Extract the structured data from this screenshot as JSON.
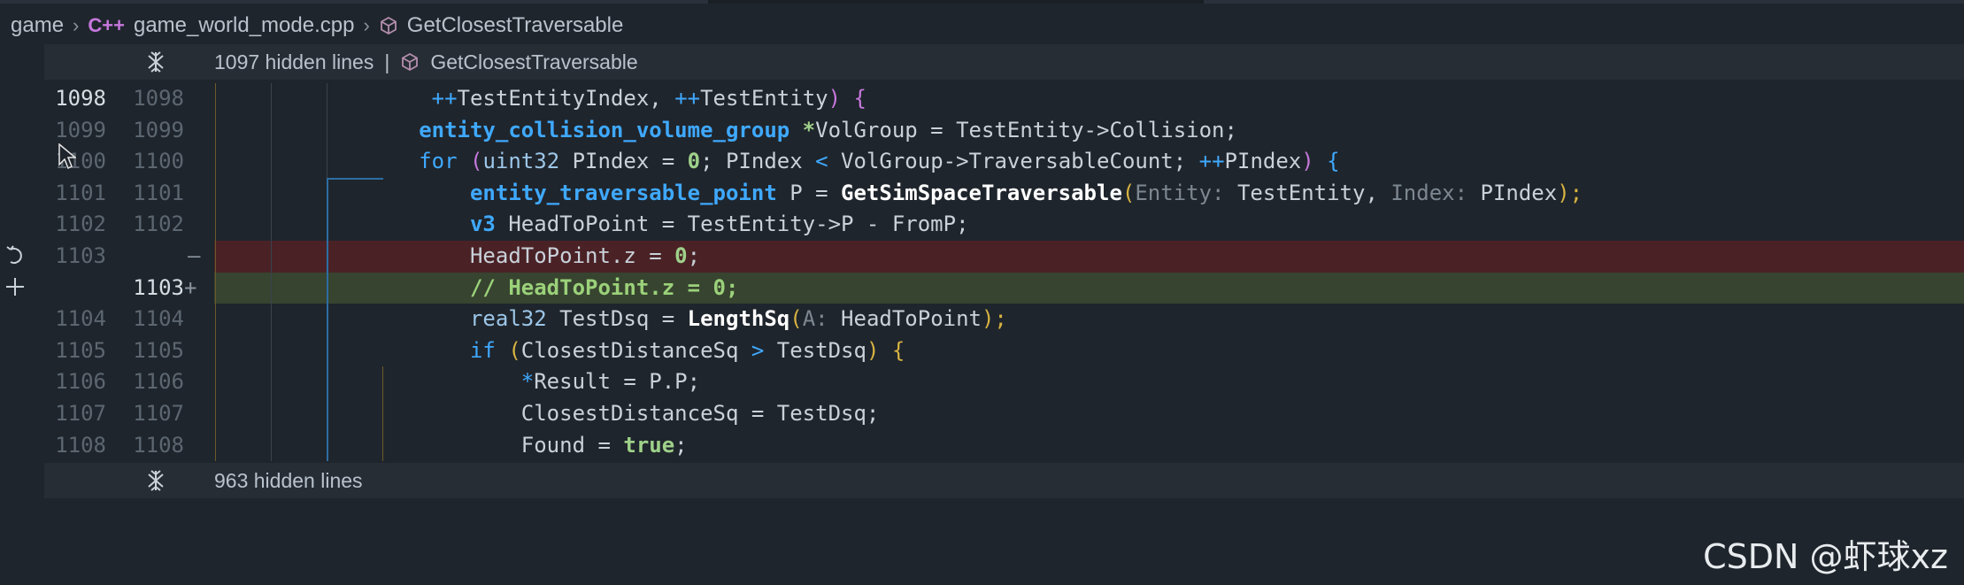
{
  "breadcrumb": {
    "folder": "game",
    "lang_badge": "C++",
    "file": "game_world_mode.cpp",
    "symbol": "GetClosestTraversable"
  },
  "fold_top": {
    "hidden": "1097 hidden lines",
    "separator": "|",
    "symbol": "GetClosestTraversable"
  },
  "fold_bottom": {
    "hidden": "963 hidden lines"
  },
  "lines": [
    {
      "old": "1098",
      "new": "1098",
      "marker": ""
    },
    {
      "old": "1099",
      "new": "1099",
      "marker": ""
    },
    {
      "old": "1100",
      "new": "1100",
      "marker": ""
    },
    {
      "old": "1101",
      "new": "1101",
      "marker": ""
    },
    {
      "old": "1102",
      "new": "1102",
      "marker": ""
    },
    {
      "old": "1103",
      "new": "",
      "marker": "—"
    },
    {
      "old": "",
      "new": "1103",
      "marker": "+"
    },
    {
      "old": "1104",
      "new": "1104",
      "marker": ""
    },
    {
      "old": "1105",
      "new": "1105",
      "marker": ""
    },
    {
      "old": "1106",
      "new": "1106",
      "marker": ""
    },
    {
      "old": "1107",
      "new": "1107",
      "marker": ""
    },
    {
      "old": "1108",
      "new": "1108",
      "marker": ""
    }
  ],
  "code": {
    "l0": {
      "a": "++",
      "b": "TestEntityIndex, ",
      "c": "++",
      "d": "TestEntity",
      "e": ")",
      "f": " {"
    },
    "l1": {
      "a": "entity_collision_volume_group",
      "b": " ",
      "c": "*",
      "d": "VolGroup = TestEntity->Collision;"
    },
    "l2": {
      "a": "for",
      "b": " (",
      "c": "uint32",
      "d": " PIndex = ",
      "e": "0",
      "f": "; PIndex ",
      "g": "<",
      "h": " VolGroup->TraversableCount; ",
      "i": "++",
      "j": "PIndex",
      "k": ")",
      "l": " {"
    },
    "l3": {
      "a": "entity_traversable_point",
      "b": " P = ",
      "c": "GetSimSpaceTraversable",
      "d": "(",
      "e": "Entity:",
      "f": " TestEntity, ",
      "g": "Index:",
      "h": " PIndex",
      "i": ");"
    },
    "l4": {
      "a": "v3",
      "b": " HeadToPoint = TestEntity->P - FromP;"
    },
    "l5": {
      "a": "HeadToPoint.z = ",
      "b": "0",
      "c": ";"
    },
    "l6": {
      "a": "// HeadToPoint.z = 0;"
    },
    "l7": {
      "a": "real32",
      "b": " TestDsq = ",
      "c": "LengthSq",
      "d": "(",
      "e": "A:",
      "f": " HeadToPoint",
      "g": ");"
    },
    "l8": {
      "a": "if",
      "b": " (",
      "c": "ClosestDistanceSq ",
      "d": ">",
      "e": " TestDsq",
      "f": ")",
      "g": " {"
    },
    "l9": {
      "a": "*",
      "b": "Result = P.P;"
    },
    "l10": {
      "a": "ClosestDistanceSq = TestDsq;"
    },
    "l11": {
      "a": "Found = ",
      "b": "true",
      "c": ";"
    }
  },
  "watermark": "CSDN @虾球xz",
  "icons": [
    "cpp-file-icon",
    "symbol-cube-icon",
    "unfold-icon",
    "revert-icon",
    "stage-plus-icon",
    "mouse-cursor-icon"
  ],
  "colors": {
    "deleted_bg": "#4a2226",
    "added_bg": "#37442f",
    "keyword": "#3fa9ff",
    "number": "#9fd18a",
    "bracket": "#d7b341"
  }
}
